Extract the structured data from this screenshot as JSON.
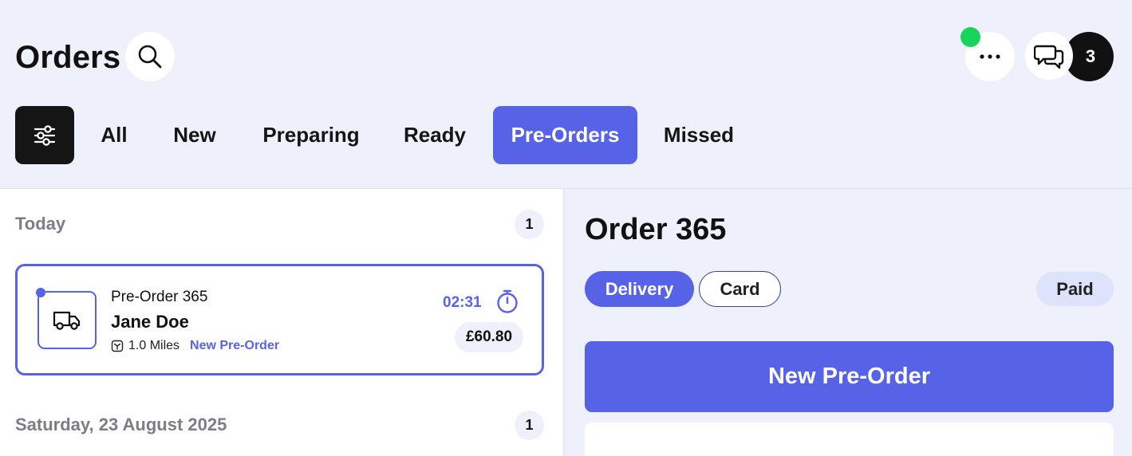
{
  "header": {
    "title": "Orders",
    "notification_count": "3",
    "icons": {
      "search": "search-icon",
      "more": "more-horizontal-icon",
      "chat": "chat-bubbles-icon",
      "filter": "sliders-icon"
    },
    "status_color": "#19d45a"
  },
  "tabs": [
    {
      "label": "All",
      "active": false
    },
    {
      "label": "New",
      "active": false
    },
    {
      "label": "Preparing",
      "active": false
    },
    {
      "label": "Ready",
      "active": false
    },
    {
      "label": "Pre-Orders",
      "active": true
    },
    {
      "label": "Missed",
      "active": false
    }
  ],
  "orders_list": {
    "groups": [
      {
        "label": "Today",
        "count": "1",
        "orders": [
          {
            "subtitle": "Pre-Order 365",
            "customer": "Jane Doe",
            "distance": "1.0 Miles",
            "status_tag": "New Pre-Order",
            "time": "02:31",
            "price": "£60.80",
            "icon": "delivery-van-icon"
          }
        ]
      },
      {
        "label": "Saturday, 23 August 2025",
        "count": "1"
      }
    ]
  },
  "detail": {
    "title": "Order 365",
    "fulfilment": "Delivery",
    "payment_method": "Card",
    "payment_status": "Paid",
    "primary_action": "New Pre-Order"
  },
  "colors": {
    "accent": "#5763e6",
    "background": "#eef1fc",
    "dark": "#151515"
  }
}
